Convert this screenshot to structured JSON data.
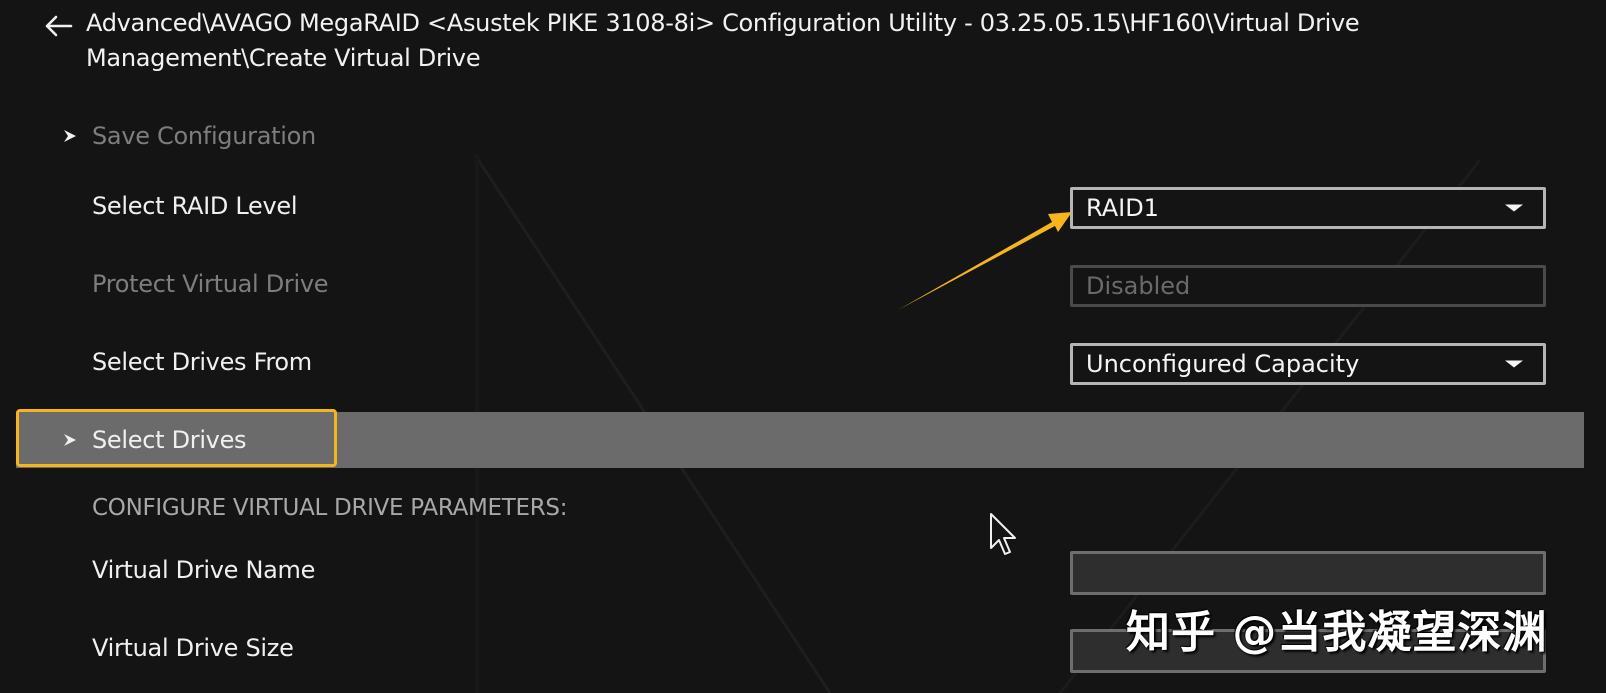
{
  "header": {
    "back_icon": "arrow-left-icon",
    "breadcrumb": "Advanced\\AVAGO MegaRAID <Asustek PIKE 3108-8i> Configuration Utility - 03.25.05.15\\HF160\\Virtual Drive Management\\Create Virtual Drive"
  },
  "menu": {
    "save_configuration": {
      "label": "Save Configuration",
      "icon": "chevron-right-icon",
      "enabled": false
    },
    "raid_level": {
      "label": "Select RAID Level",
      "value": "RAID1",
      "control": "dropdown"
    },
    "protect_virtual_drive": {
      "label": "Protect Virtual Drive",
      "value": "Disabled",
      "enabled": false
    },
    "drives_from": {
      "label": "Select Drives From",
      "value": "Unconfigured Capacity",
      "control": "dropdown"
    },
    "select_drives": {
      "label": "Select Drives",
      "icon": "chevron-right-icon",
      "selected": true
    },
    "section_header": "CONFIGURE VIRTUAL DRIVE PARAMETERS:",
    "vd_name": {
      "label": "Virtual Drive Name",
      "value": ""
    },
    "vd_size": {
      "label": "Virtual Drive Size",
      "value": ""
    }
  },
  "annotation": {
    "highlight_color": "#f5b51c",
    "arrow_color": "#f5b51c",
    "arrow_target": "raid-level-dropdown"
  },
  "watermark": "知乎 @当我凝望深渊",
  "colors": {
    "background": "#141414",
    "selected_row": "#6b6b6b",
    "text_primary": "#f0f0f0",
    "text_disabled": "#7d7d7d"
  }
}
